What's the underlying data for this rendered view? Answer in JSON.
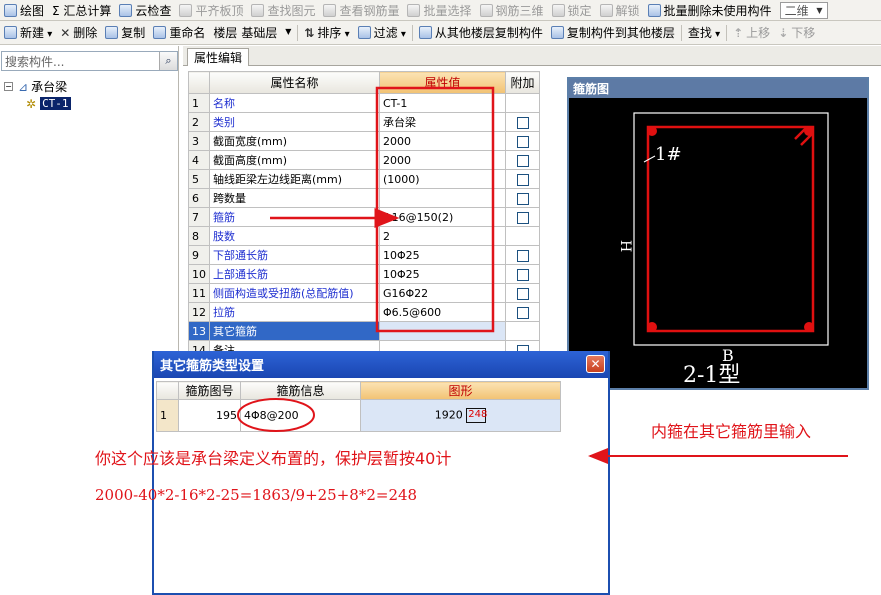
{
  "toolbar1": [
    {
      "label": "绘图",
      "icon": "pencil-icon",
      "enabled": true
    },
    {
      "label": "Σ 汇总计算",
      "icon": "",
      "enabled": true
    },
    {
      "label": "云检查",
      "icon": "check-icon",
      "enabled": true
    },
    {
      "label": "平齐板顶",
      "icon": "align-icon",
      "enabled": false
    },
    {
      "label": "查找图元",
      "icon": "find-icon",
      "enabled": false
    },
    {
      "label": "查看钢筋量",
      "icon": "view-rebar-icon",
      "enabled": false
    },
    {
      "label": "批量选择",
      "icon": "batch-select-icon",
      "enabled": false
    },
    {
      "label": "钢筋三维",
      "icon": "rebar-3d-icon",
      "enabled": false
    },
    {
      "label": "锁定",
      "icon": "lock-icon",
      "enabled": false
    },
    {
      "label": "解锁",
      "icon": "unlock-icon",
      "enabled": false
    },
    {
      "label": "批量删除未使用构件",
      "icon": "batch-delete-icon",
      "enabled": true
    }
  ],
  "view_mode": "二维",
  "toolbar2": {
    "new": "新建",
    "delete": "删除",
    "copy": "复制",
    "rename": "重命名",
    "floor_label": "楼层",
    "floor_value": "基础层",
    "sort": "排序",
    "filter": "过滤",
    "copy_from": "从其他楼层复制构件",
    "copy_to": "复制构件到其他楼层",
    "find": "查找",
    "move_up": "上移",
    "move_down": "下移"
  },
  "left_panel": {
    "search_placeholder": "搜索构件...",
    "tree_root": "承台梁",
    "tree_child": "CT-1"
  },
  "tab_label": "属性编辑",
  "property_table": {
    "headers": {
      "name": "属性名称",
      "value": "属性值",
      "attach": "附加"
    },
    "rows": [
      {
        "no": "1",
        "name": "名称",
        "value": "CT-1",
        "blue": true,
        "check": false
      },
      {
        "no": "2",
        "name": "类别",
        "value": "承台梁",
        "blue": true,
        "check": true
      },
      {
        "no": "3",
        "name": "截面宽度(mm)",
        "value": "2000",
        "blue": false,
        "check": true
      },
      {
        "no": "4",
        "name": "截面高度(mm)",
        "value": "2000",
        "blue": false,
        "check": true
      },
      {
        "no": "5",
        "name": "轴线距梁左边线距离(mm)",
        "value": "(1000)",
        "blue": false,
        "check": true
      },
      {
        "no": "6",
        "name": "跨数量",
        "value": "",
        "blue": false,
        "check": true
      },
      {
        "no": "7",
        "name": "箍筋",
        "value": "Φ16@150(2)",
        "blue": true,
        "check": true
      },
      {
        "no": "8",
        "name": "肢数",
        "value": "2",
        "blue": true,
        "check": false
      },
      {
        "no": "9",
        "name": "下部通长筋",
        "value": "10Φ25",
        "blue": true,
        "check": true
      },
      {
        "no": "10",
        "name": "上部通长筋",
        "value": "10Φ25",
        "blue": true,
        "check": true
      },
      {
        "no": "11",
        "name": "侧面构造或受扭筋(总配筋值)",
        "value": "G16Φ22",
        "blue": true,
        "check": true
      },
      {
        "no": "12",
        "name": "拉筋",
        "value": "Φ6.5@600",
        "blue": true,
        "check": true
      },
      {
        "no": "13",
        "name": "其它箍筋",
        "value": "",
        "blue": false,
        "check": false,
        "selected": true
      },
      {
        "no": "14",
        "name": "备注",
        "value": "",
        "blue": false,
        "check": true
      }
    ]
  },
  "rebar_diagram": {
    "title": "箍筋图",
    "bar_label": "1#",
    "height_label": "H",
    "width_label": "B",
    "type_label": "2-1型"
  },
  "dialog": {
    "title": "其它箍筋类型设置",
    "headers": {
      "fig_no": "箍筋图号",
      "info": "箍筋信息",
      "shape": "图形"
    },
    "row": {
      "no": "1",
      "fig_no": "195",
      "info": "4Φ8@200",
      "shape_value": "1920",
      "shape_inner": "248"
    }
  },
  "annotations": {
    "right_note": "内箍在其它箍筋里输入",
    "main_note": "你这个应该是承台梁定义布置的，保护层暂按40计",
    "formula": "2000-40*2-16*2-25=1863/9+25+8*2=248"
  }
}
